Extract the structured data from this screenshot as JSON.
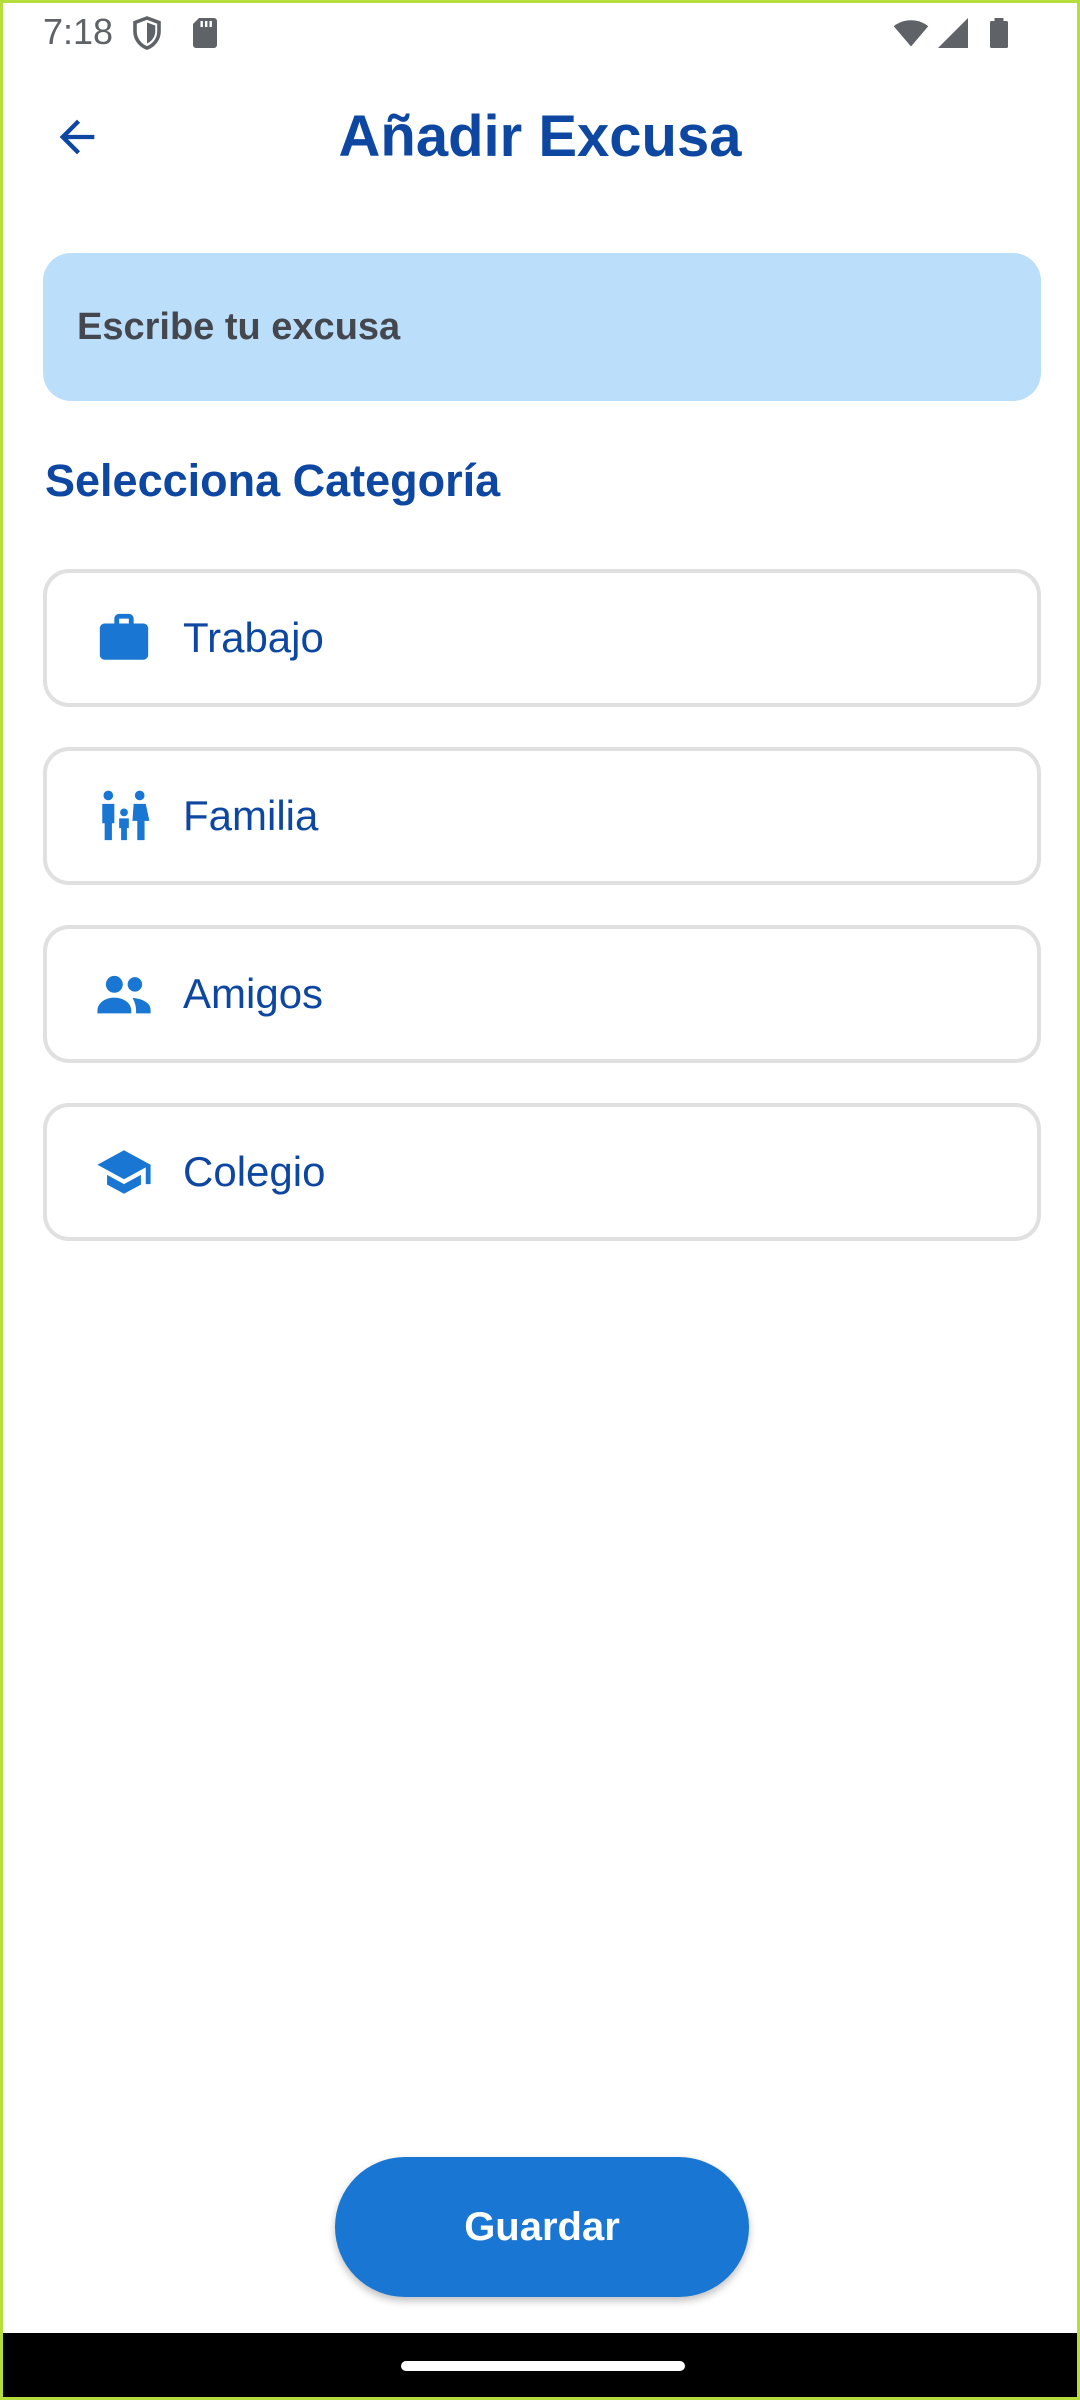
{
  "status_bar": {
    "time": "7:18",
    "icons": [
      "shield-icon",
      "sd-card-icon",
      "wifi-icon",
      "signal-icon",
      "battery-icon"
    ]
  },
  "header": {
    "back_icon": "arrow-left-icon",
    "title": "Añadir Excusa"
  },
  "excuse_input": {
    "placeholder": "Escribe tu excusa",
    "value": ""
  },
  "categories": {
    "heading": "Selecciona Categoría",
    "items": [
      {
        "label": "Trabajo",
        "icon": "briefcase-icon"
      },
      {
        "label": "Familia",
        "icon": "family-icon"
      },
      {
        "label": "Amigos",
        "icon": "people-icon"
      },
      {
        "label": "Colegio",
        "icon": "school-icon"
      }
    ]
  },
  "actions": {
    "save_label": "Guardar"
  },
  "colors": {
    "primary": "#0d47a1",
    "accent": "#1976d2",
    "input_bg": "#bbdefb",
    "icon": "#1976d2"
  }
}
